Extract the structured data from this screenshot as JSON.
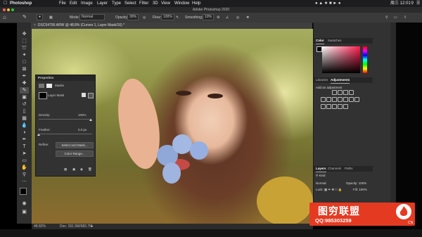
{
  "menubar": {
    "app": "Photoshop",
    "items": [
      "File",
      "Edit",
      "Image",
      "Layer",
      "Type",
      "Select",
      "Filter",
      "3D",
      "View",
      "Window",
      "Help"
    ],
    "clock": "周三 12:01"
  },
  "window_title": "Adobe Photoshop 2020",
  "options_bar": {
    "mode_label": "Mode:",
    "mode_value": "Normal",
    "opacity_label": "Opacity:",
    "opacity_value": "30%",
    "flow_label": "Flow:",
    "flow_value": "100%",
    "smoothing_label": "Smoothing:",
    "smoothing_value": "10%"
  },
  "document": {
    "tab_title": "DSC04790.ARW @ 48.8% (Curves 1, Layer Mask/16) *",
    "zoom": "48.82%",
    "doc_info": "Doc: 261.5M/683.7M"
  },
  "properties": {
    "title": "Properties",
    "masks_label": "Masks",
    "layer_mask_label": "Layer Mask",
    "density_label": "Density:",
    "density_value": "100%",
    "feather_label": "Feather:",
    "feather_value": "0.0 px",
    "refine_label": "Refine:",
    "select_mask_button": "Select and Mask...",
    "color_range_button": "Color Range..."
  },
  "color_panel": {
    "tabs": [
      "Color",
      "Swatches"
    ]
  },
  "adjustments_panel": {
    "tabs": [
      "Libraries",
      "Adjustments"
    ],
    "hint": "Add an adjustment"
  },
  "layers_panel": {
    "tabs": [
      "Layers",
      "Channels",
      "Paths"
    ],
    "kind_label": "Kind",
    "blend_mode": "Normal",
    "opacity_label": "Opacity:",
    "opacity_value": "100%",
    "lock_label": "Lock:",
    "fill_label": "Fill:",
    "fill_value": "100%"
  },
  "watermark": {
    "title": "图穷联盟",
    "qq": "QQ:985303259",
    "badge": "CN"
  },
  "colors": {
    "accent": "#e53a22",
    "panel": "#323232",
    "menubar": "#1d1d1f"
  }
}
